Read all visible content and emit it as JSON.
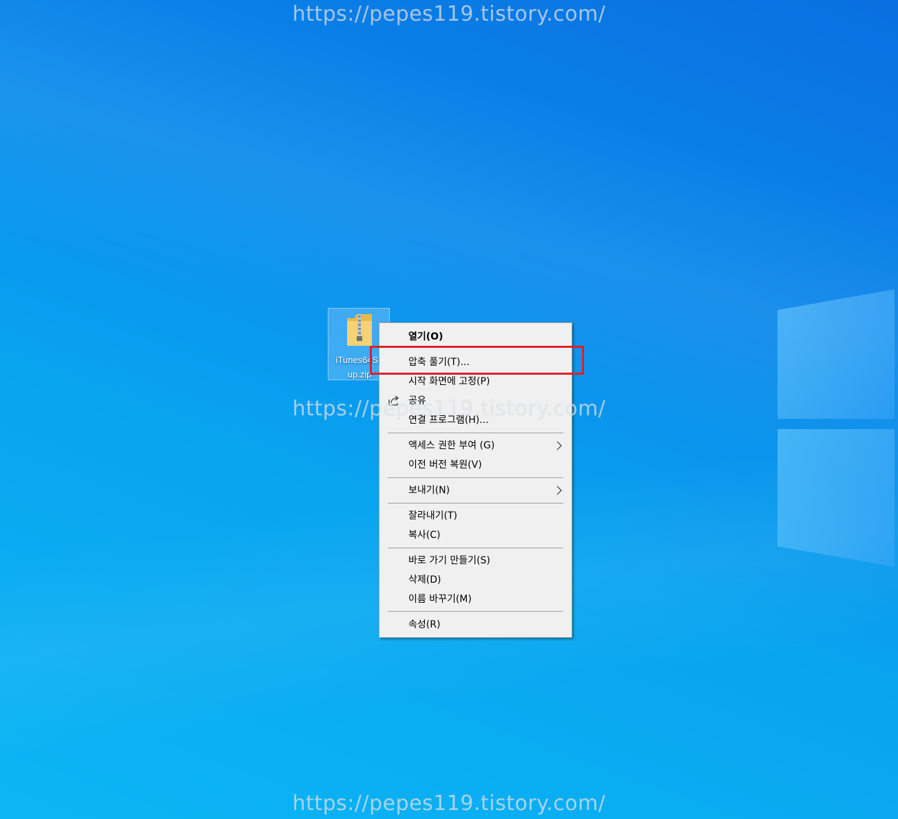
{
  "desktop": {
    "watermark_text": "https://pepes119.tistory.com/",
    "file": {
      "name_line1": "iTunes64Se",
      "name_line2": "up.zip",
      "icon": "zip-folder-icon"
    }
  },
  "context_menu": {
    "items": [
      {
        "label": "열기(O)",
        "bold": true
      },
      {
        "label": "압축 풀기(T)..."
      },
      {
        "label": "시작 화면에 고정(P)"
      },
      {
        "label": "공유",
        "icon": "share-icon"
      },
      {
        "label": "연결 프로그램(H)..."
      },
      {
        "label": "액세스 권한 부여 (G)",
        "submenu": true
      },
      {
        "label": "이전 버전 복원(V)"
      },
      {
        "label": "보내기(N)",
        "submenu": true
      },
      {
        "label": "잘라내기(T)"
      },
      {
        "label": "복사(C)"
      },
      {
        "label": "바로 가기 만들기(S)"
      },
      {
        "label": "삭제(D)"
      },
      {
        "label": "이름 바꾸기(M)"
      },
      {
        "label": "속성(R)"
      }
    ]
  },
  "colors": {
    "highlight": "#e01e2a",
    "menu_bg": "#f0f0f0",
    "desktop_blue": "#0a8ae8"
  }
}
